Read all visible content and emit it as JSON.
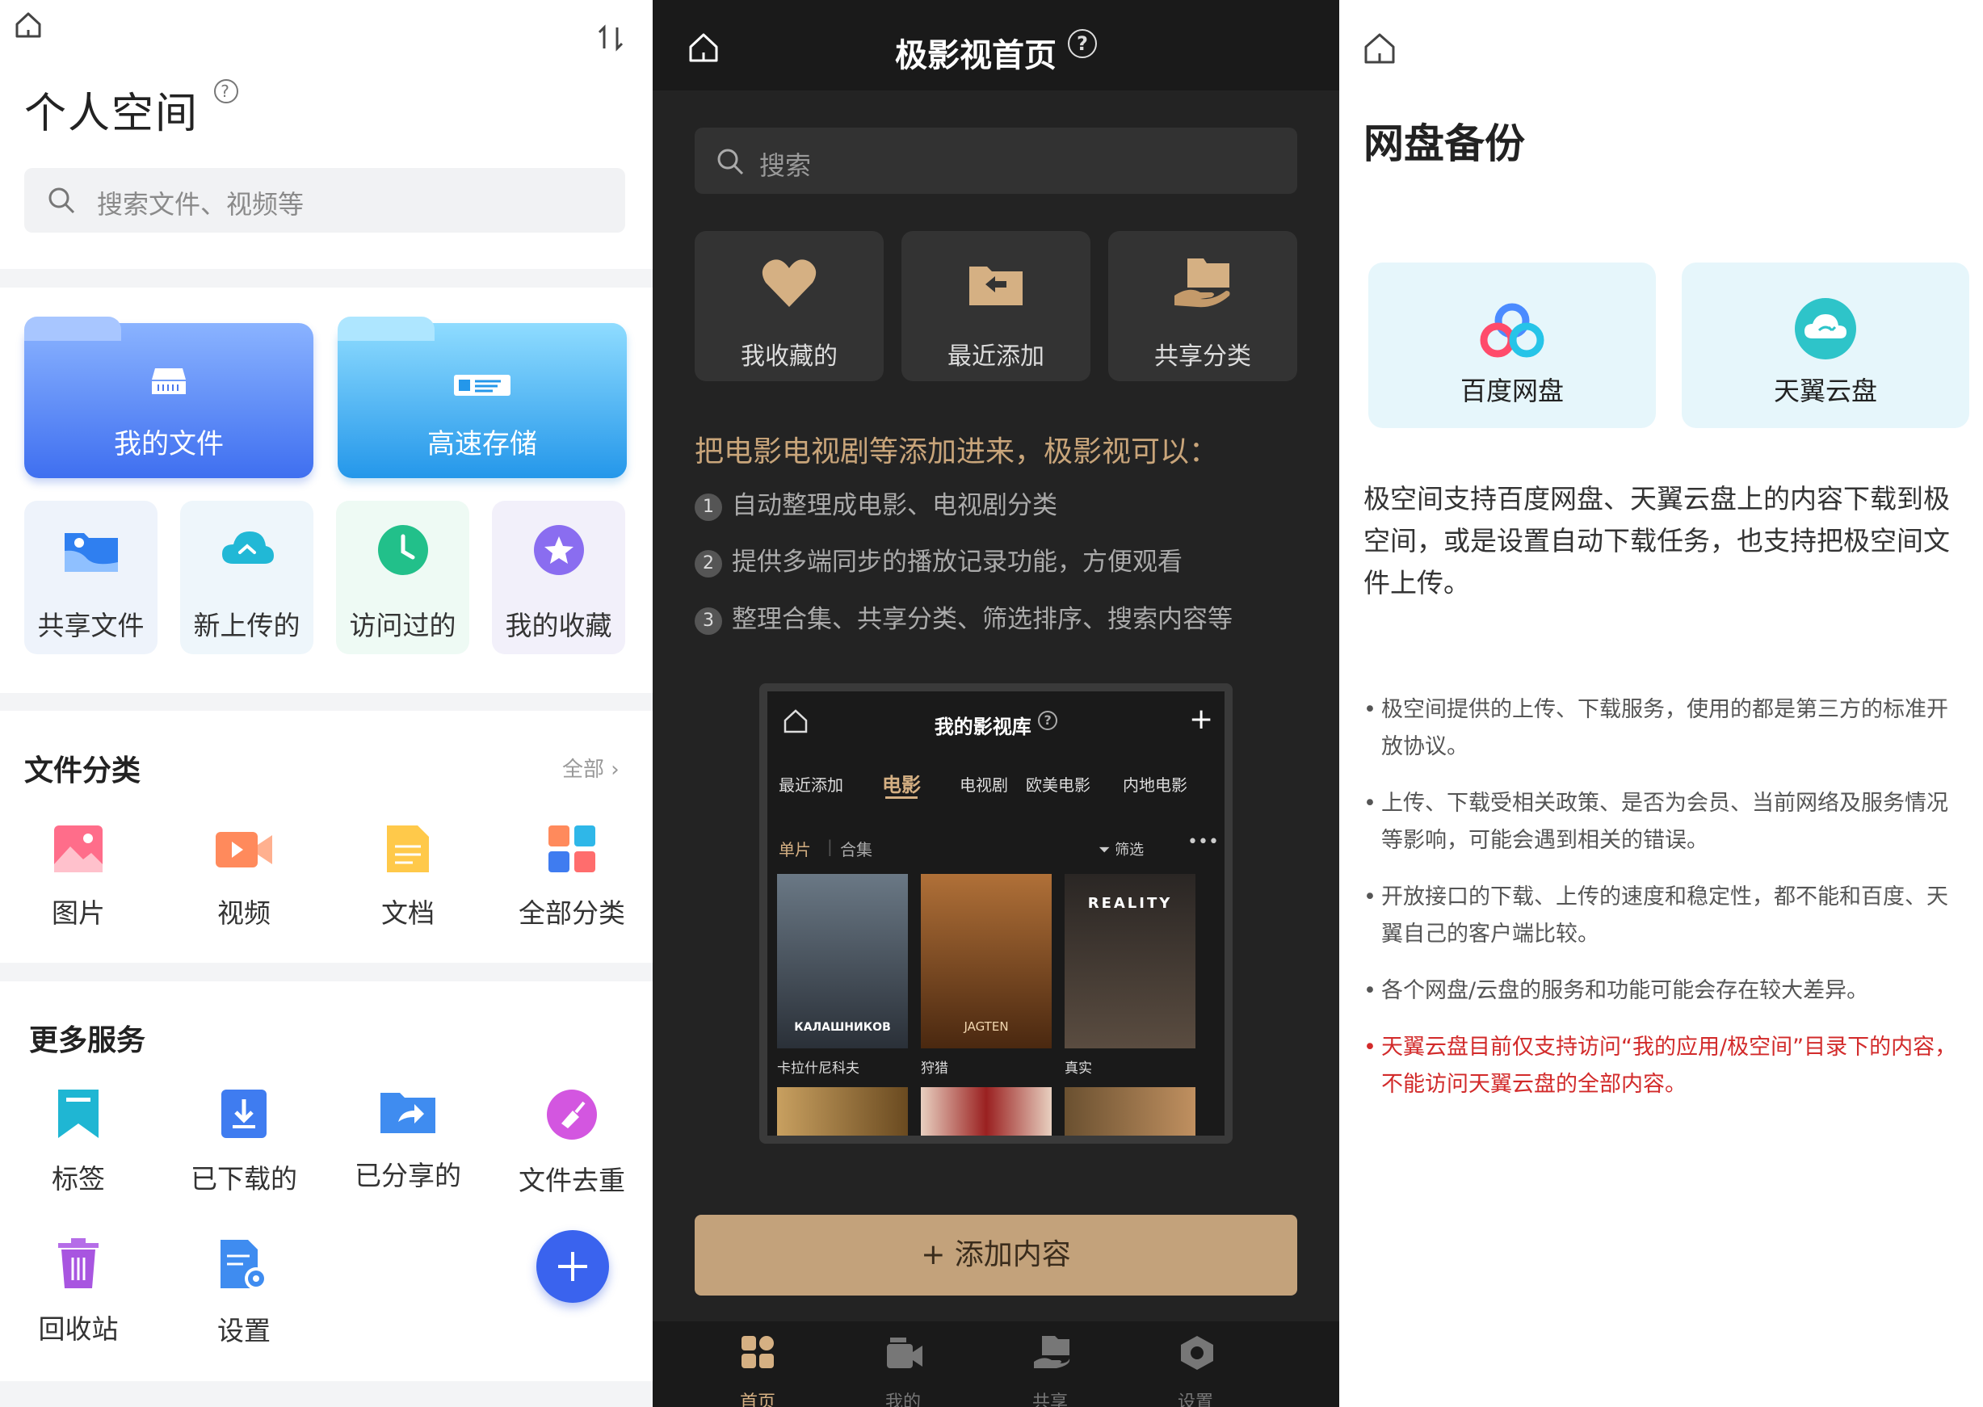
{
  "left": {
    "title": "个人空间",
    "search_placeholder": "搜索文件、视频等",
    "folders": [
      {
        "label": "我的文件"
      },
      {
        "label": "高速存储"
      }
    ],
    "quick": [
      {
        "label": "共享文件"
      },
      {
        "label": "新上传的"
      },
      {
        "label": "访问过的"
      },
      {
        "label": "我的收藏"
      }
    ],
    "file_categories": {
      "title": "文件分类",
      "all_link": "全部 ›",
      "items": [
        {
          "label": "图片"
        },
        {
          "label": "视频"
        },
        {
          "label": "文档"
        },
        {
          "label": "全部分类"
        }
      ]
    },
    "more_services": {
      "title": "更多服务",
      "items": [
        {
          "label": "标签"
        },
        {
          "label": "已下载的"
        },
        {
          "label": "已分享的"
        },
        {
          "label": "文件去重"
        },
        {
          "label": "回收站"
        },
        {
          "label": "设置"
        }
      ]
    }
  },
  "middle": {
    "title": "极影视首页",
    "search_placeholder": "搜索",
    "cards": [
      {
        "label": "我收藏的"
      },
      {
        "label": "最近添加"
      },
      {
        "label": "共享分类"
      }
    ],
    "intro": "把电影电视剧等添加进来，极影视可以：",
    "steps": [
      {
        "n": "1",
        "text": "自动整理成电影、电视剧分类"
      },
      {
        "n": "2",
        "text": "提供多端同步的播放记录功能，方便观看"
      },
      {
        "n": "3",
        "text": "整理合集、共享分类、筛选排序、搜索内容等"
      }
    ],
    "preview": {
      "title": "我的影视库",
      "tabs": [
        "最近添加",
        "电影",
        "电视剧",
        "欧美电影",
        "内地电影"
      ],
      "active_tab": "电影",
      "sub_left": "单片",
      "sub_sep": "|",
      "sub_right": "合集",
      "filter": "筛选",
      "posters": [
        {
          "caption": "卡拉什尼科夫",
          "poster_text": "КАЛАШНИКОВ",
          "color": "#4a5560"
        },
        {
          "caption": "狩猎",
          "poster_text": "JAGTEN",
          "color": "#8a4a20"
        },
        {
          "caption": "真实",
          "poster_text": "REALITY",
          "color": "#3a3530"
        }
      ]
    },
    "add_button": "+ 添加内容",
    "tabbar": [
      {
        "label": "首页",
        "active": true
      },
      {
        "label": "我的",
        "active": false
      },
      {
        "label": "共享",
        "active": false
      },
      {
        "label": "设置",
        "active": false
      }
    ]
  },
  "right": {
    "title": "网盘备份",
    "cards": [
      {
        "label": "百度网盘"
      },
      {
        "label": "天翼云盘"
      }
    ],
    "description": "极空间支持百度网盘、天翼云盘上的内容下载到极空间，或是设置自动下载任务，也支持把极空间文件上传。",
    "notes": [
      {
        "text": "极空间提供的上传、下载服务，使用的都是第三方的标准开放协议。",
        "red": false
      },
      {
        "text": "上传、下载受相关政策、是否为会员、当前网络及服务情况等影响，可能会遇到相关的错误。",
        "red": false
      },
      {
        "text": "开放接口的下载、上传的速度和稳定性，都不能和百度、天翼自己的客户端比较。",
        "red": false
      },
      {
        "text": "各个网盘/云盘的服务和功能可能会存在较大差异。",
        "red": false
      },
      {
        "text": "天翼云盘目前仅支持访问“我的应用/极空间”目录下的内容，不能访问天翼云盘的全部内容。",
        "red": true
      }
    ]
  },
  "colors": {
    "accent_blue": "#3f6ff0",
    "gold": "#c3a27b",
    "note_red": "#d22a2a"
  }
}
